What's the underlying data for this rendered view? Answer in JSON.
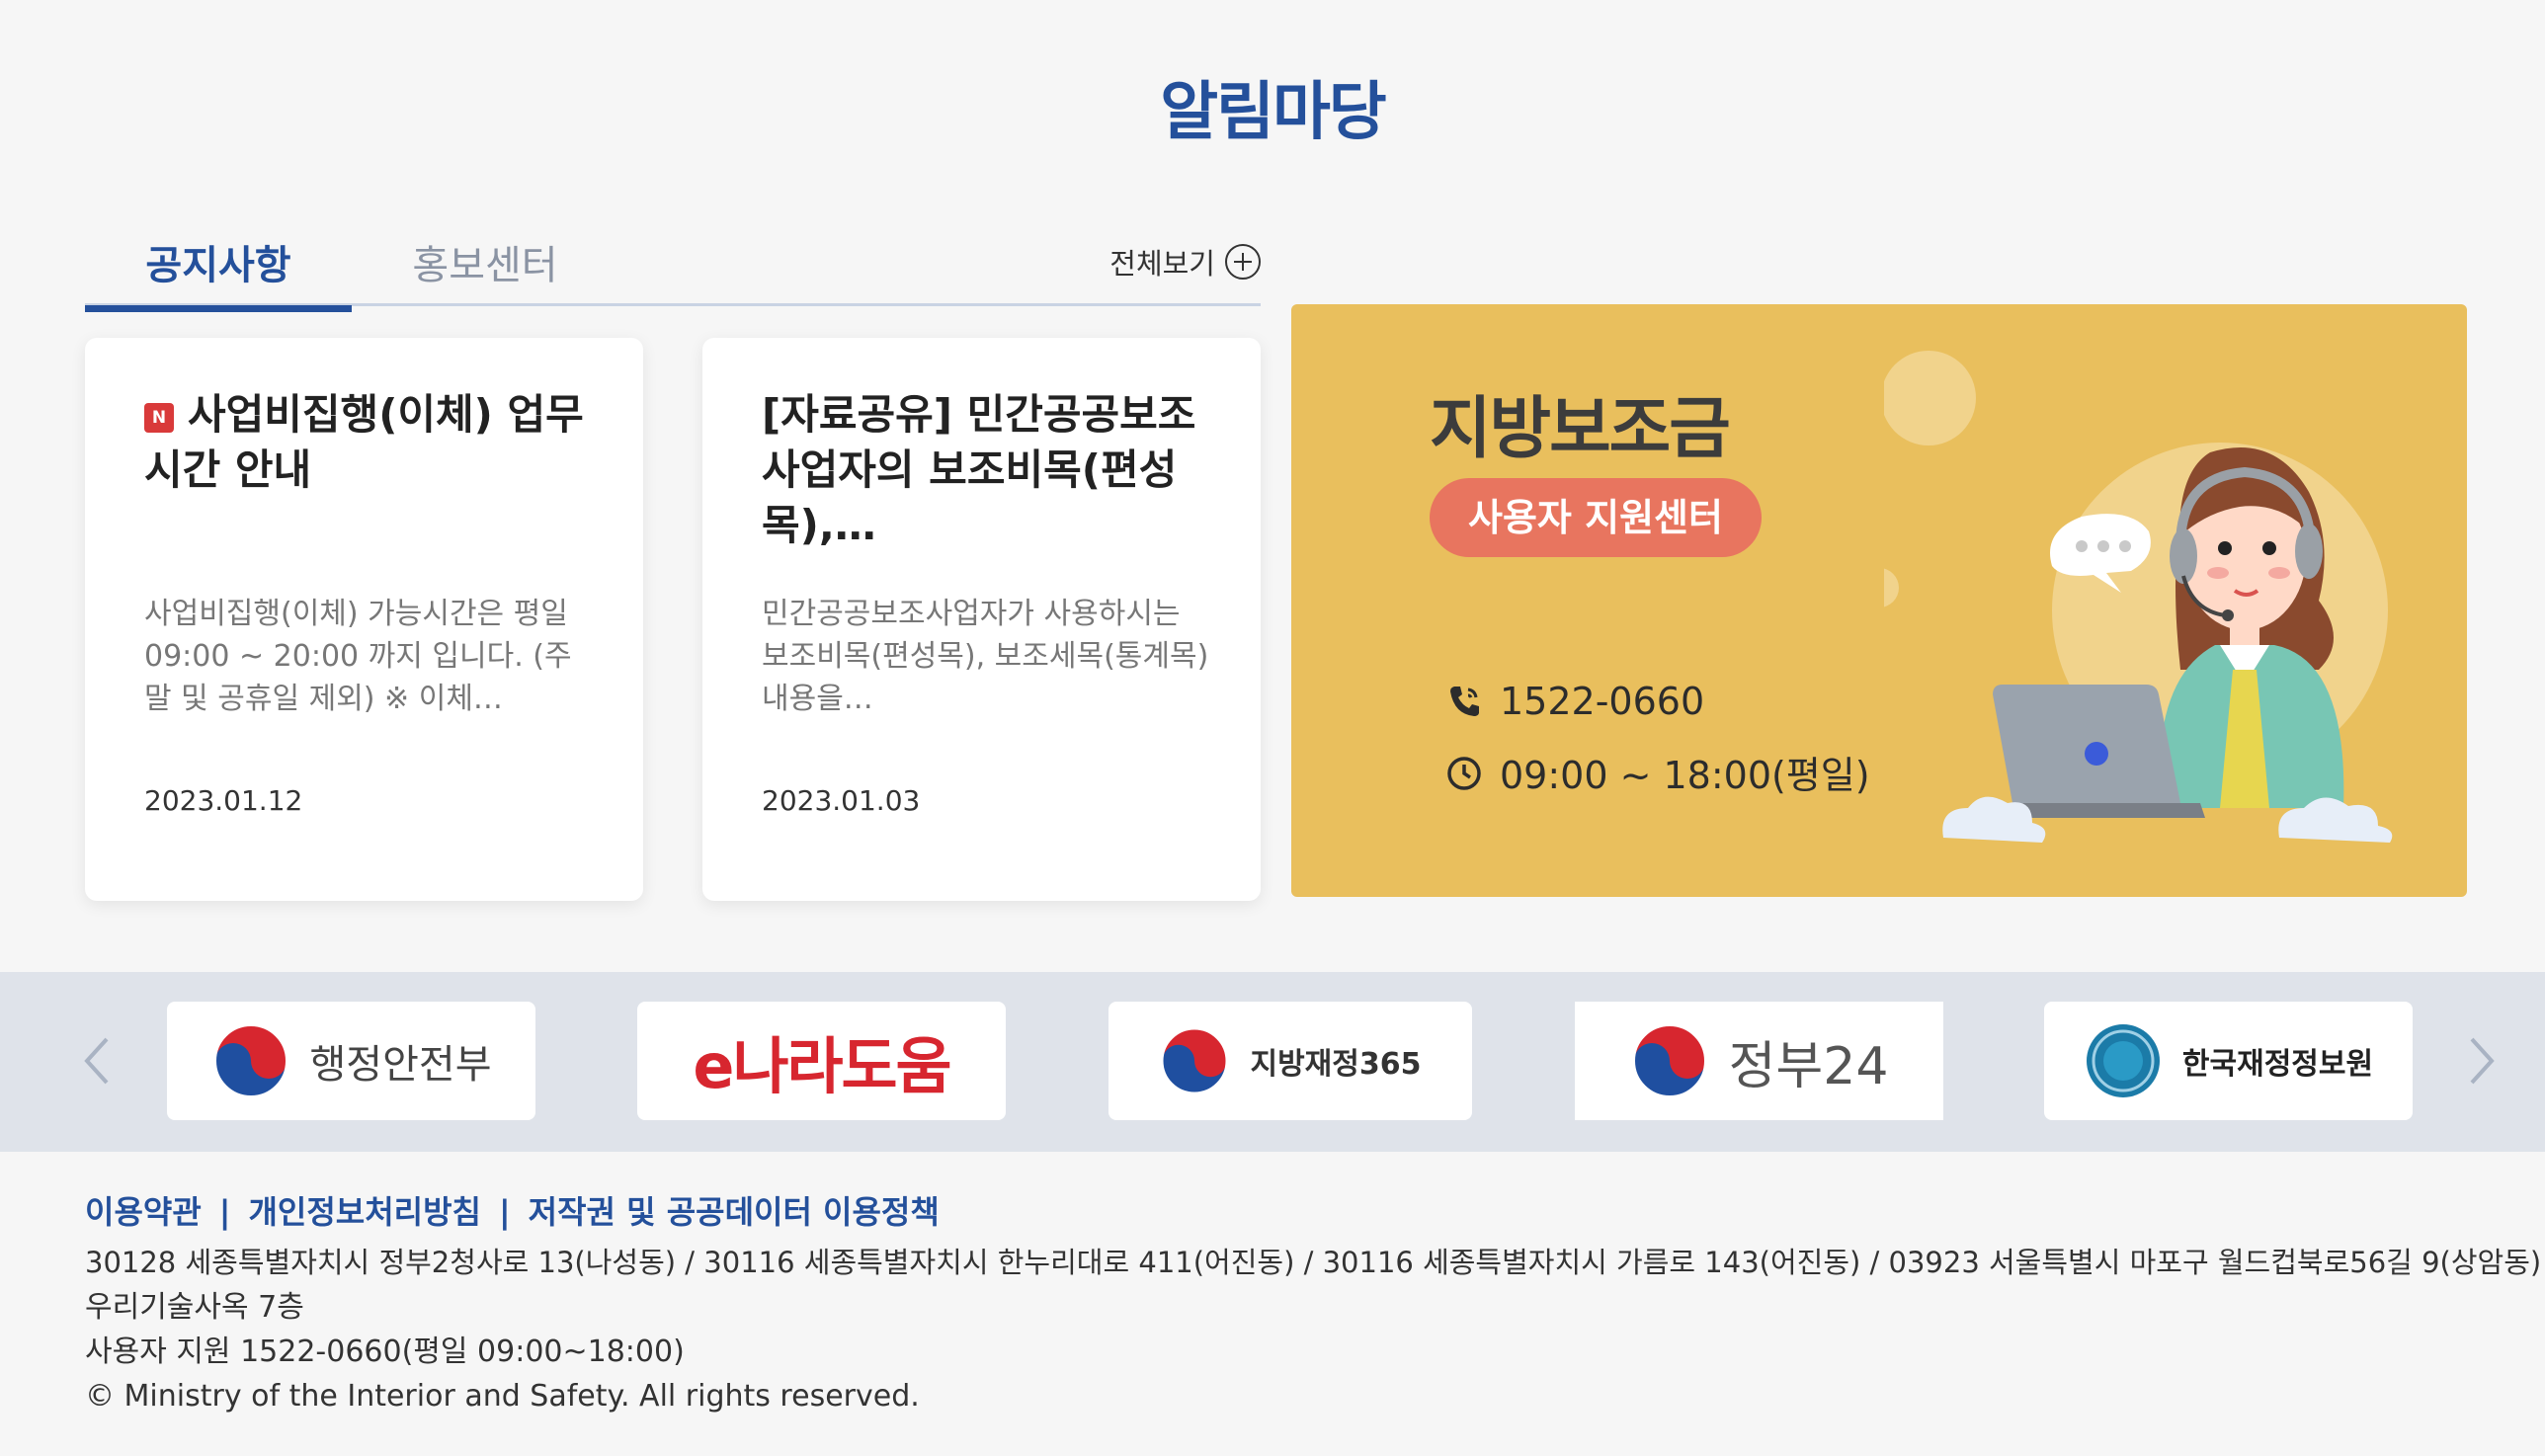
{
  "page": {
    "title": "알림마당"
  },
  "tabs": {
    "notice": "공지사항",
    "promo": "홍보센터",
    "view_all": "전체보기"
  },
  "cards": [
    {
      "badge": "N",
      "title": "사업비집행(이체) 업무시간 안내",
      "desc": "사업비집행(이체) 가능시간은 평일 09:00 ~ 20:00 까지 입니다. (주말 및 공휴일 제외) ※ 이체…",
      "date": "2023.01.12"
    },
    {
      "title": "[자료공유] 민간공공보조사업자의 보조비목(편성목),…",
      "desc": "민간공공보조사업자가 사용하시는 보조비목(편성목), 보조세목(통계목) 내용을…",
      "date": "2023.01.03"
    }
  ],
  "banner": {
    "title": "지방보조금",
    "pill": "사용자 지원센터",
    "phone": "1522-0660",
    "hours": "09:00 ~ 18:00(평일)",
    "bg_color": "#e9bf5d",
    "pill_color": "#e8755f"
  },
  "partners": [
    {
      "name": "행정안전부",
      "icon": "taegeuk-icon"
    },
    {
      "name": "e나라도움"
    },
    {
      "name": "지방재정365",
      "icon": "taegeuk-icon"
    },
    {
      "name": "정부24",
      "icon": "taegeuk-icon"
    },
    {
      "name": "한국재정정보원",
      "icon": "kpfis-emblem-icon"
    }
  ],
  "footer": {
    "links": [
      "이용약관",
      "개인정보처리방침",
      "저작권 및 공공데이터 이용정책"
    ],
    "separator": "|",
    "address_1": "30128 세종특별자치시 정부2청사로 13(나성동) / 30116 세종특별자치시 한누리대로 411(어진동) / 30116 세종특별자치시 가름로 143(어진동) / 03923 서울특별시 마포구 월드컵북로56길 9(상암동)",
    "address_2": "우리기술사옥 7층",
    "support": "사용자 지원 1522-0660(평일 09:00~18:00)",
    "copyright": "© Ministry of the Interior and Safety. All rights reserved."
  },
  "colors": {
    "accent": "#24509b",
    "badge": "#d93a3a"
  }
}
